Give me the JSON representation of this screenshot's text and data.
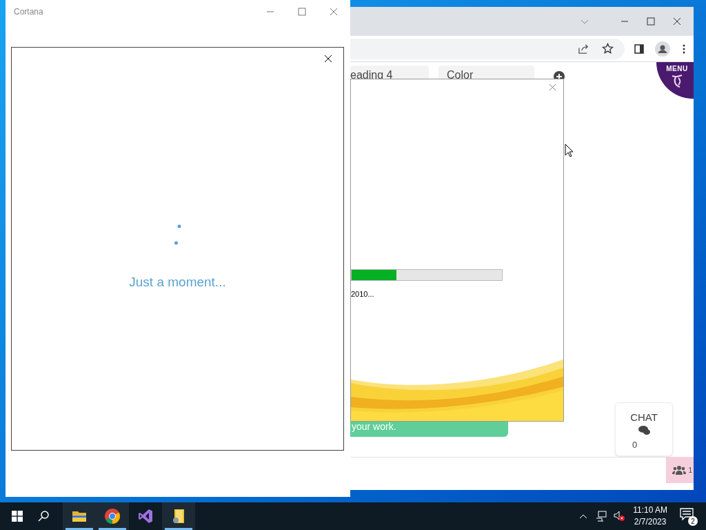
{
  "browser": {
    "chips": [
      {
        "label": "eading 4"
      },
      {
        "label": "Color"
      }
    ],
    "menu_label": "MENU",
    "banner_text": "your work.",
    "chat": {
      "title": "CHAT",
      "count": "0"
    },
    "participants": "1"
  },
  "installer": {
    "progress": {
      "level": 0.3
    },
    "status": "2010..."
  },
  "cortana": {
    "title": "Cortana",
    "message": "Just a moment..."
  },
  "taskbar": {
    "apps": [
      {
        "kind": "folder",
        "open": true
      },
      {
        "kind": "chrome",
        "open": true
      },
      {
        "kind": "studio",
        "open": false
      },
      {
        "kind": "installer",
        "open": true
      }
    ],
    "time": "11:10 AM",
    "date": "2/7/2023",
    "notifications": "2"
  }
}
